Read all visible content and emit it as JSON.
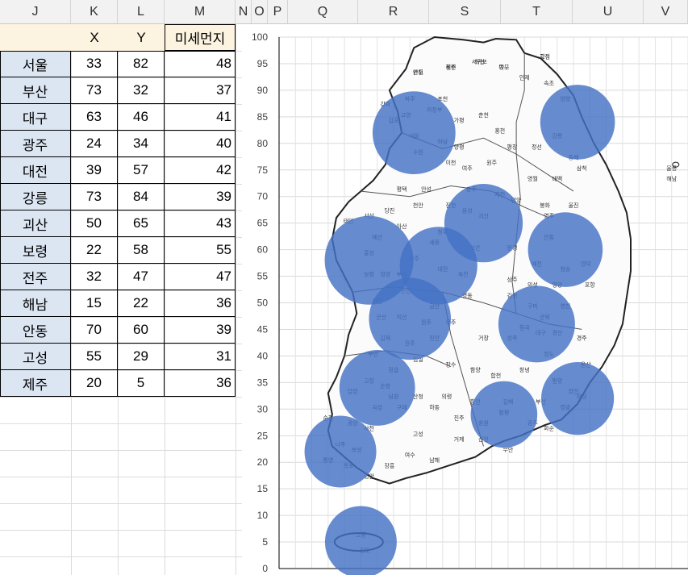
{
  "columns": [
    "J",
    "K",
    "L",
    "M",
    "N",
    "O",
    "P",
    "Q",
    "R",
    "S",
    "T",
    "U",
    "V"
  ],
  "table": {
    "headers": [
      "X",
      "Y",
      "미세먼지"
    ],
    "rows": [
      {
        "city": "서울",
        "x": 33,
        "y": 82,
        "dust": 48
      },
      {
        "city": "부산",
        "x": 73,
        "y": 32,
        "dust": 37
      },
      {
        "city": "대구",
        "x": 63,
        "y": 46,
        "dust": 41
      },
      {
        "city": "광주",
        "x": 24,
        "y": 34,
        "dust": 40
      },
      {
        "city": "대전",
        "x": 39,
        "y": 57,
        "dust": 42
      },
      {
        "city": "강릉",
        "x": 73,
        "y": 84,
        "dust": 39
      },
      {
        "city": "괴산",
        "x": 50,
        "y": 65,
        "dust": 43
      },
      {
        "city": "보령",
        "x": 22,
        "y": 58,
        "dust": 55
      },
      {
        "city": "전주",
        "x": 32,
        "y": 47,
        "dust": 47
      },
      {
        "city": "해남",
        "x": 15,
        "y": 22,
        "dust": 36
      },
      {
        "city": "안동",
        "x": 70,
        "y": 60,
        "dust": 39
      },
      {
        "city": "고성",
        "x": 55,
        "y": 29,
        "dust": 31
      },
      {
        "city": "제주",
        "x": 20,
        "y": 5,
        "dust": 36
      }
    ]
  },
  "colors": {
    "bubble": "#4472c4",
    "header_fill": "#fdf3e1",
    "city_fill": "#dce6f3",
    "grid": "#dcdcdc"
  },
  "map_labels": [
    "고성",
    "연천",
    "철원",
    "화천",
    "양구",
    "인제",
    "속초",
    "강화",
    "파주",
    "포천",
    "양양",
    "김포",
    "고양",
    "의정부",
    "가평",
    "춘천",
    "홍천",
    "강릉",
    "서울",
    "하남",
    "양평",
    "평창",
    "정선",
    "동해",
    "삼척",
    "수원",
    "이천",
    "여주",
    "원주",
    "영월",
    "태백",
    "평택",
    "안성",
    "충주",
    "제천",
    "단양",
    "봉화",
    "울진",
    "울릉",
    "천안",
    "진천",
    "음성",
    "괴산",
    "영주",
    "태안",
    "서산",
    "당진",
    "아산",
    "청주",
    "예산",
    "홍성",
    "공주",
    "세종",
    "보은",
    "문경",
    "예천",
    "안동",
    "청송",
    "영덕",
    "보령",
    "청양",
    "부여",
    "논산",
    "대전",
    "옥천",
    "상주",
    "의성",
    "영양",
    "포항",
    "서천",
    "금산",
    "영동",
    "김천",
    "구미",
    "군위",
    "영천",
    "경주",
    "군산",
    "익산",
    "완주",
    "무주",
    "칠곡",
    "대구",
    "경산",
    "김제",
    "전주",
    "진안",
    "거창",
    "성주",
    "청도",
    "울산",
    "부안",
    "정읍",
    "임실",
    "장수",
    "함양",
    "합천",
    "창녕",
    "밀양",
    "양산",
    "고창",
    "순창",
    "남원",
    "산청",
    "의령",
    "함안",
    "김해",
    "부산",
    "영광",
    "장성",
    "담양",
    "곡성",
    "구례",
    "하동",
    "진주",
    "창원",
    "함평",
    "광주",
    "화순",
    "순천",
    "광양",
    "사천",
    "고성",
    "거제",
    "신안",
    "무안",
    "나주",
    "보성",
    "여수",
    "남해",
    "통영",
    "목포",
    "영암",
    "장흥",
    "고흥",
    "진도",
    "해남",
    "강진",
    "완도",
    "제주",
    "서귀포",
    "독도"
  ],
  "chart_data": {
    "type": "scatter",
    "xlim": [
      0,
      100
    ],
    "ylim": [
      0,
      100
    ],
    "yticks": [
      0,
      5,
      10,
      15,
      20,
      25,
      30,
      35,
      40,
      45,
      50,
      55,
      60,
      65,
      70,
      75,
      80,
      85,
      90,
      95,
      100
    ],
    "grid": true,
    "background": "map of South Korea",
    "series": [
      {
        "x": [
          33,
          73,
          63,
          24,
          39,
          73,
          50,
          22,
          32,
          15,
          70,
          55,
          20
        ],
        "y": [
          82,
          32,
          46,
          34,
          57,
          84,
          65,
          58,
          47,
          22,
          60,
          29,
          5
        ],
        "size": [
          48,
          37,
          41,
          40,
          42,
          39,
          43,
          55,
          47,
          36,
          39,
          31,
          36
        ]
      }
    ]
  }
}
